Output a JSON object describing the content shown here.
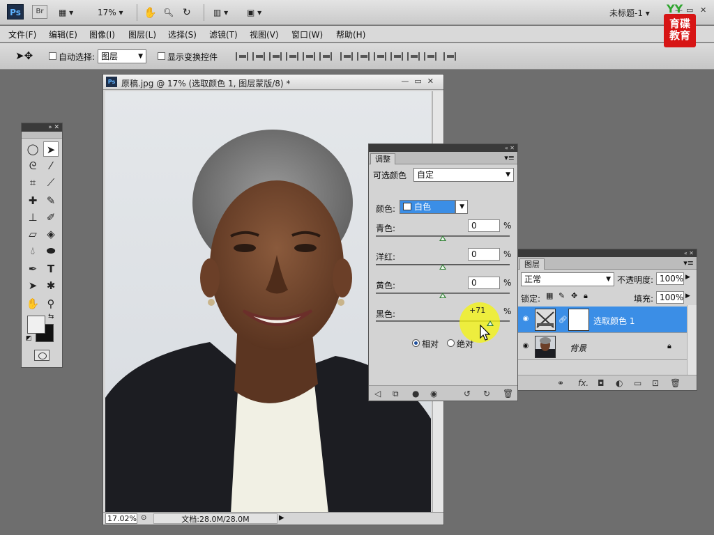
{
  "app": {
    "logo": "Ps",
    "bridge": "Br",
    "zoom": "17%",
    "doc_title": "未标题-1",
    "brand_lines": [
      "育碟",
      "教育"
    ],
    "brand_mark": "YY"
  },
  "menu": [
    "文件(F)",
    "编辑(E)",
    "图像(I)",
    "图层(L)",
    "选择(S)",
    "滤镜(T)",
    "视图(V)",
    "窗口(W)",
    "帮助(H)"
  ],
  "options": {
    "auto_select_label": "自动选择:",
    "auto_select_value": "图层",
    "show_transform_label": "显示变换控件"
  },
  "document": {
    "title": "原稿.jpg @ 17% (选取颜色 1, 图层蒙版/8) *",
    "zoom": "17.02%",
    "info": "文档:28.0M/28.0M"
  },
  "adjustments": {
    "tab": "调整",
    "title": "可选颜色",
    "preset": "自定",
    "color_label": "颜色:",
    "color_value": "白色",
    "sliders": [
      {
        "label": "青色:",
        "value": "0",
        "fraction": 0.5
      },
      {
        "label": "洋红:",
        "value": "0",
        "fraction": 0.5
      },
      {
        "label": "黄色:",
        "value": "0",
        "fraction": 0.5
      },
      {
        "label": "黑色:",
        "value": "",
        "fraction": 0.855
      }
    ],
    "hover_value": "+71",
    "percent": "%",
    "method_relative": "相对",
    "method_absolute": "绝对"
  },
  "layers": {
    "tab": "图层",
    "blend_mode": "正常",
    "opacity_label": "不透明度:",
    "opacity": "100%",
    "lock_label": "锁定:",
    "fill_label": "填充:",
    "fill": "100%",
    "items": [
      {
        "name": "选取颜色 1",
        "selected": true
      },
      {
        "name": "背景",
        "selected": false
      }
    ]
  }
}
